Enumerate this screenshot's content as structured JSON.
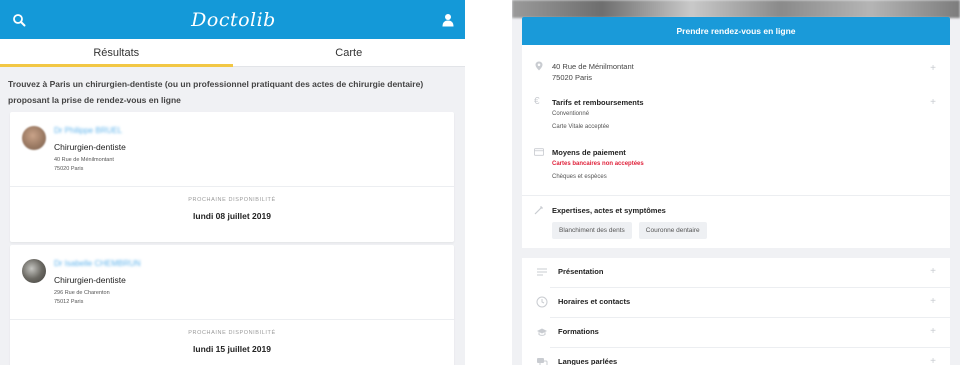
{
  "left": {
    "topbar": {
      "logo": "Doctolib",
      "search_icon": "search-icon",
      "user_icon": "user-icon"
    },
    "tabs": [
      {
        "label": "Résultats",
        "active": true
      },
      {
        "label": "Carte",
        "active": false
      }
    ],
    "intro": "Trouvez à Paris un chirurgien-dentiste (ou un professionnel pratiquant des actes de chirurgie dentaire) proposant la prise de rendez-vous en ligne",
    "results": [
      {
        "name": "Dr Philippe BRUEL",
        "specialty": "Chirurgien-dentiste",
        "address_line1": "40 Rue de Ménilmontant",
        "address_line2": "75020 Paris",
        "availability_label": "PROCHAINE DISPONIBILITÉ",
        "availability_date": "lundi 08 juillet 2019"
      },
      {
        "name": "Dr Isabelle CHEMBRUN",
        "specialty": "Chirurgien-dentiste",
        "address_line1": "296 Rue de Charenton",
        "address_line2": "75012 Paris",
        "availability_label": "PROCHAINE DISPONIBILITÉ",
        "availability_date": "lundi 15 juillet 2019"
      }
    ]
  },
  "right": {
    "cta_label": "Prendre rendez-vous en ligne",
    "address": {
      "line1": "40 Rue de Ménilmontant",
      "line2": "75020 Paris"
    },
    "tarifs": {
      "title": "Tarifs et remboursements",
      "line1": "Conventionné",
      "line2": "Carte Vitale acceptée"
    },
    "paiement": {
      "title": "Moyens de paiement",
      "warning": "Cartes bancaires non acceptées",
      "line2": "Chèques et espèces"
    },
    "expertises": {
      "title": "Expertises, actes et symptômes",
      "chips": [
        "Blanchiment des dents",
        "Couronne dentaire"
      ]
    },
    "sections": [
      {
        "label": "Présentation",
        "icon": "text-icon"
      },
      {
        "label": "Horaires et contacts",
        "icon": "clock-icon"
      },
      {
        "label": "Formations",
        "icon": "graduation-icon"
      },
      {
        "label": "Langues parlées",
        "icon": "chat-icon"
      }
    ],
    "plus_symbol": "+"
  },
  "colors": {
    "brand": "#1499d8",
    "tab_indicator": "#f2c744",
    "warning": "#e0233c",
    "link": "#5eb3ec"
  }
}
